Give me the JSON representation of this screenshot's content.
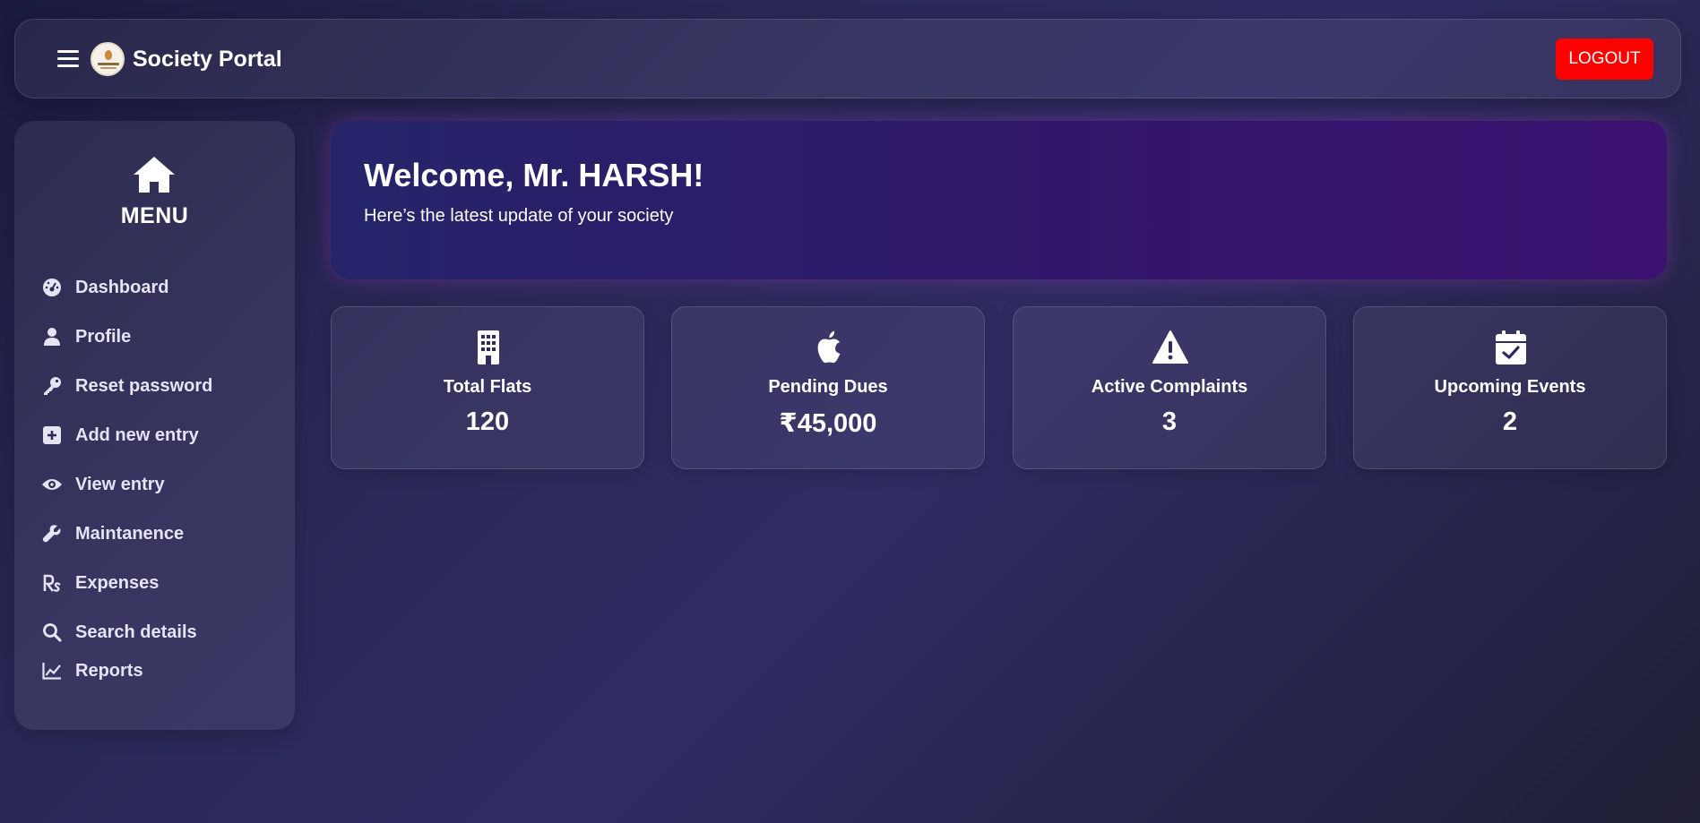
{
  "navbar": {
    "brand": "Society Portal",
    "logout_label": "LOGOUT",
    "menu_icon": "hamburger-icon",
    "logo": "society-logo"
  },
  "sidebar": {
    "title": "MENU",
    "title_icon": "home-icon",
    "items": [
      {
        "label": "Dashboard",
        "icon": "dashboard-gauge-icon"
      },
      {
        "label": "Profile",
        "icon": "user-icon"
      },
      {
        "label": "Reset password",
        "icon": "key-icon"
      },
      {
        "label": "Add new entry",
        "icon": "plus-square-icon"
      },
      {
        "label": "View entry",
        "icon": "eye-icon"
      },
      {
        "label": "Maintanence",
        "icon": "wrench-icon"
      },
      {
        "label": "Expenses",
        "icon": "rupee-rs-icon"
      },
      {
        "label": "Search details",
        "icon": "search-icon"
      },
      {
        "label": "Reports",
        "icon": "line-chart-icon"
      }
    ]
  },
  "welcome": {
    "heading": "Welcome, Mr. HARSH!",
    "subheading": "Here’s the latest update of your society"
  },
  "stats": [
    {
      "title": "Total Flats",
      "value": "120",
      "icon": "building-icon"
    },
    {
      "title": "Pending Dues",
      "value": "₹45,000",
      "icon": "apple-icon"
    },
    {
      "title": "Active Complaints",
      "value": "3",
      "icon": "warning-triangle-icon"
    },
    {
      "title": "Upcoming Events",
      "value": "2",
      "icon": "calendar-check-icon"
    }
  ],
  "colors": {
    "logout_button": "#ff0000",
    "welcome_gradient_start": "#26256a",
    "welcome_gradient_end": "#3c1170"
  }
}
